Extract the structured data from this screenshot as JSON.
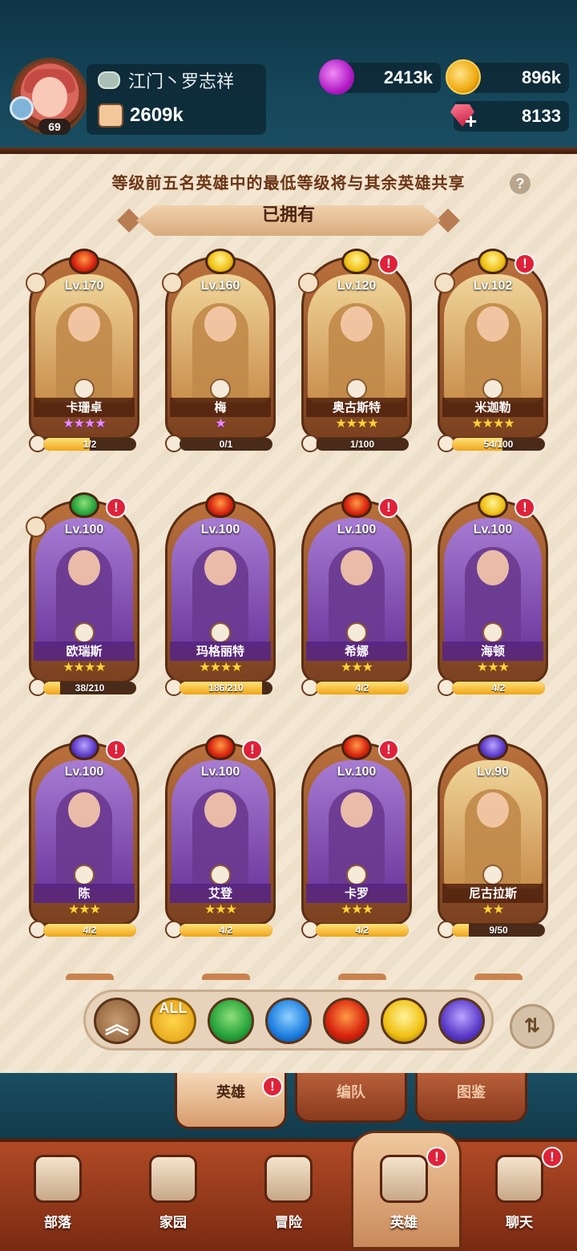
{
  "player": {
    "name": "江门丶罗志祥",
    "level": "69",
    "power": "2609k"
  },
  "resources": {
    "elixir": "2413k",
    "gold": "896k",
    "gems": "8133"
  },
  "notice": "等级前五名英雄中的最低等级将与其余英雄共享",
  "section_title": "已拥有",
  "heroes": [
    {
      "level": "Lv.170",
      "name": "卡珊卓",
      "stars": "★★★★",
      "progress": "1/2",
      "element": "fire",
      "bg": "gold",
      "alert": false,
      "team": true,
      "star_color": "pink",
      "fill": 0.5
    },
    {
      "level": "Lv.160",
      "name": "梅",
      "stars": "★",
      "progress": "0/1",
      "element": "light",
      "bg": "gold",
      "alert": false,
      "team": true,
      "star_color": "pink",
      "fill": 0.0
    },
    {
      "level": "Lv.120",
      "name": "奥古斯特",
      "stars": "★★★★",
      "progress": "1/100",
      "element": "light",
      "bg": "gold",
      "alert": true,
      "team": true,
      "star_color": "gold",
      "fill": 0.01
    },
    {
      "level": "Lv.102",
      "name": "米迦勒",
      "stars": "★★★★",
      "progress": "54/100",
      "element": "light",
      "bg": "gold",
      "alert": true,
      "team": true,
      "star_color": "gold",
      "fill": 0.54
    },
    {
      "level": "Lv.100",
      "name": "欧瑞斯",
      "stars": "★★★★",
      "progress": "38/210",
      "element": "nature",
      "bg": "purple",
      "alert": true,
      "team": true,
      "star_color": "gold",
      "fill": 0.18
    },
    {
      "level": "Lv.100",
      "name": "玛格丽特",
      "stars": "★★★★",
      "progress": "186/210",
      "element": "fire",
      "bg": "purple",
      "alert": false,
      "team": false,
      "star_color": "gold",
      "fill": 0.89
    },
    {
      "level": "Lv.100",
      "name": "希娜",
      "stars": "★★★",
      "progress": "4/2",
      "element": "fire",
      "bg": "purple",
      "alert": true,
      "team": false,
      "star_color": "gold",
      "fill": 1.0
    },
    {
      "level": "Lv.100",
      "name": "海顿",
      "stars": "★★★",
      "progress": "4/2",
      "element": "light",
      "bg": "purple",
      "alert": true,
      "team": false,
      "star_color": "gold",
      "fill": 1.0
    },
    {
      "level": "Lv.100",
      "name": "陈",
      "stars": "★★★",
      "progress": "4/2",
      "element": "dark",
      "bg": "purple",
      "alert": true,
      "team": false,
      "star_color": "gold",
      "fill": 1.0
    },
    {
      "level": "Lv.100",
      "name": "艾登",
      "stars": "★★★",
      "progress": "4/2",
      "element": "fire",
      "bg": "purple",
      "alert": true,
      "team": false,
      "star_color": "gold",
      "fill": 1.0
    },
    {
      "level": "Lv.100",
      "name": "卡罗",
      "stars": "★★★",
      "progress": "4/2",
      "element": "fire",
      "bg": "purple",
      "alert": true,
      "team": false,
      "star_color": "gold",
      "fill": 1.0
    },
    {
      "level": "Lv.90",
      "name": "尼古拉斯",
      "stars": "★★",
      "progress": "9/50",
      "element": "dark",
      "bg": "gold",
      "alert": false,
      "team": false,
      "star_color": "gold",
      "fill": 0.18
    }
  ],
  "filters": {
    "all_label": "ALL",
    "items": [
      "collapse",
      "all",
      "nature",
      "water",
      "fire",
      "light",
      "dark"
    ]
  },
  "subtabs": [
    {
      "label": "英雄",
      "active": true,
      "alert": true
    },
    {
      "label": "编队",
      "active": false,
      "alert": false
    },
    {
      "label": "图鉴",
      "active": false,
      "alert": false
    }
  ],
  "nav": [
    {
      "label": "部落",
      "active": false,
      "alert": false
    },
    {
      "label": "家园",
      "active": false,
      "alert": false
    },
    {
      "label": "冒险",
      "active": false,
      "alert": false
    },
    {
      "label": "英雄",
      "active": true,
      "alert": true
    },
    {
      "label": "聊天",
      "active": false,
      "alert": true
    }
  ],
  "alert_mark": "!",
  "colors": {
    "header_bg": "#15465a",
    "panel_bg": "#f2e4cf",
    "nav_bg": "#b04a26",
    "alert": "#e0213a",
    "star_gold": "#ffd23a"
  }
}
